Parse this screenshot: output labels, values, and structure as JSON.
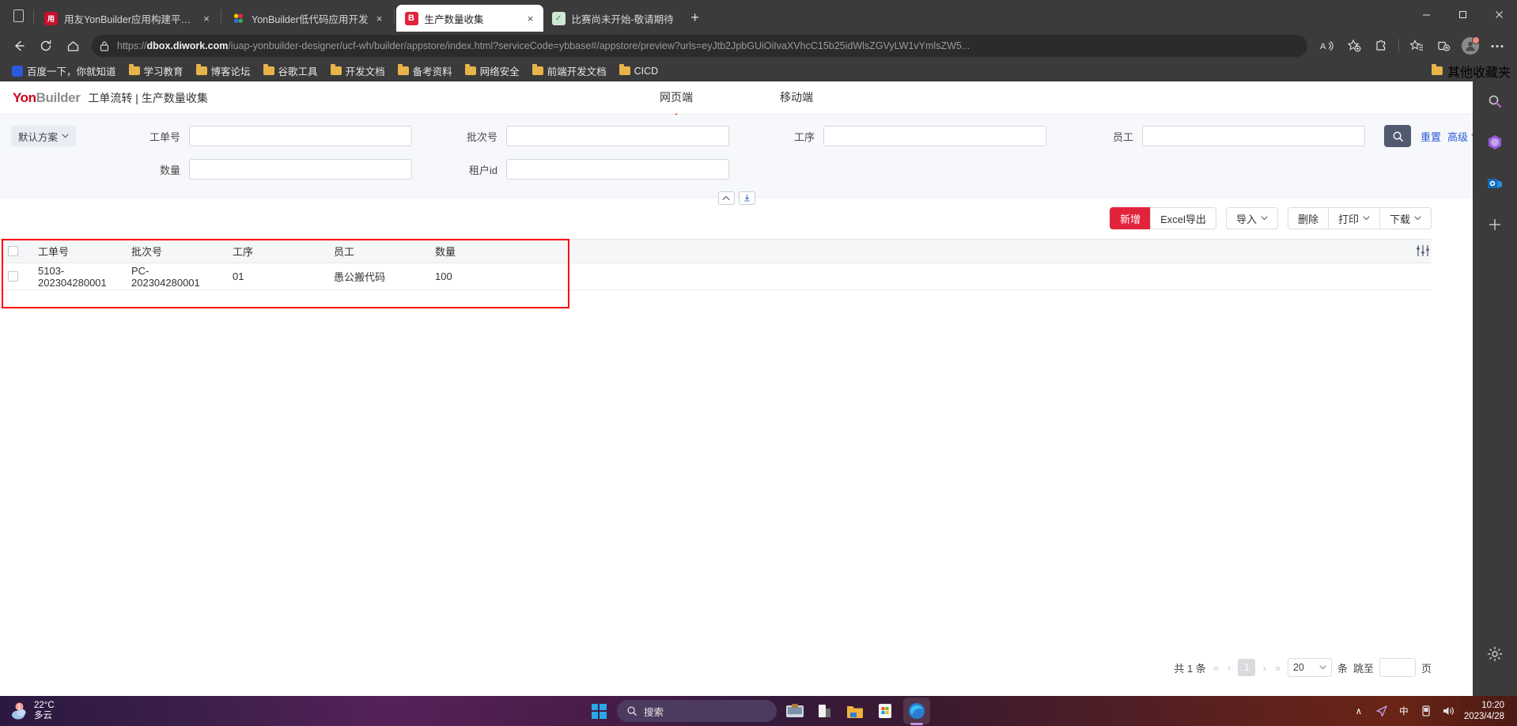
{
  "browser": {
    "tabs": [
      {
        "title": "用友YonBuilder应用构建平台-可",
        "favicon_text": "用",
        "favicon_color": "#c8102e",
        "active": false,
        "close_label": "×"
      },
      {
        "title": "YonBuilder低代码应用开发",
        "favicon_text": "❖",
        "favicon_color": "#f2f2f2",
        "active": false,
        "close_label": "×"
      },
      {
        "title": "生产数量收集",
        "favicon_text": "B",
        "favicon_color": "#e1243b",
        "active": true,
        "close_label": "×"
      },
      {
        "title": "比赛尚未开始-敬请期待",
        "favicon_text": "✓",
        "favicon_color": "#2d8a4e",
        "active": false,
        "close_label": "×"
      }
    ],
    "new_tab_label": "+",
    "window_controls": {
      "minimize": "—",
      "maximize": "☐",
      "close": "×"
    },
    "nav": {
      "back_icon": "back-arrow",
      "reload_icon": "reload",
      "home_icon": "home",
      "url_prefix": "https://",
      "url_domain": "dbox.diwork.com",
      "url_path": "/iuap-yonbuilder-designer/ucf-wh/builder/appstore/index.html?serviceCode=ybbase#/appstore/preview?urls=eyJtb2JpbGUiOiIvaXVhcC15b25idWlsZGVyLW1vYmlsZW5..."
    },
    "bookmarks": [
      {
        "label": "百度一下，你就知道",
        "icon": "baidu-icon"
      },
      {
        "label": "学习教育",
        "icon": "folder-icon"
      },
      {
        "label": "博客论坛",
        "icon": "folder-icon"
      },
      {
        "label": "谷歌工具",
        "icon": "folder-icon"
      },
      {
        "label": "开发文档",
        "icon": "folder-icon"
      },
      {
        "label": "备考资料",
        "icon": "folder-icon"
      },
      {
        "label": "网络安全",
        "icon": "folder-icon"
      },
      {
        "label": "前端开发文档",
        "icon": "folder-icon"
      },
      {
        "label": "CICD",
        "icon": "folder-icon"
      }
    ],
    "other_bookmarks": "其他收藏夹"
  },
  "app": {
    "logo_yon": "Yon",
    "logo_builder": "Builder",
    "breadcrumb": "工单流转 | 生产数量收集",
    "segments": [
      {
        "label": "网页端",
        "active": true
      },
      {
        "label": "移动端",
        "active": false
      }
    ]
  },
  "search": {
    "scheme_label": "默认方案",
    "fields": [
      {
        "label": "工单号",
        "value": "",
        "placeholder": ""
      },
      {
        "label": "批次号",
        "value": "",
        "placeholder": ""
      },
      {
        "label": "工序",
        "value": "",
        "placeholder": ""
      },
      {
        "label": "员工",
        "value": "",
        "placeholder": ""
      },
      {
        "label": "数量",
        "value": "",
        "placeholder": ""
      },
      {
        "label": "租户id",
        "value": "",
        "placeholder": ""
      }
    ],
    "search_button_icon": "search-icon",
    "reset_label": "重置",
    "advanced_label": "高级",
    "collapse_icon": "chevron-up-icon",
    "pin_icon": "pin-icon"
  },
  "toolbar": {
    "add_label": "新增",
    "excel_export_label": "Excel导出",
    "import_label": "导入",
    "delete_label": "删除",
    "print_label": "打印",
    "download_label": "下载",
    "columns_icon": "column-settings-icon"
  },
  "table": {
    "columns": [
      "工单号",
      "批次号",
      "工序",
      "员工",
      "数量",
      ""
    ],
    "rows": [
      {
        "cells": [
          "5103-202304280001",
          "PC-202304280001",
          "01",
          "愚公搬代码",
          "100",
          ""
        ]
      }
    ]
  },
  "pagination": {
    "total_label": "共 1 条",
    "first_icon": "«",
    "prev_icon": "‹",
    "current_page": "1",
    "next_icon": "›",
    "last_icon": "»",
    "page_size": "20",
    "unit_label": "条",
    "jump_label": "跳至",
    "jump_value": "",
    "page_label": "页"
  },
  "taskbar": {
    "weather_temp": "22°C",
    "weather_desc": "多云",
    "weather_badge": "1",
    "start_icon": "windows-start-icon",
    "search_placeholder": "搜索",
    "apps": [
      {
        "name": "file-explorer-icon"
      },
      {
        "name": "camera-icon"
      },
      {
        "name": "notes-icon"
      },
      {
        "name": "folder-icon"
      },
      {
        "name": "store-icon"
      },
      {
        "name": "edge-icon"
      }
    ],
    "tray": {
      "overflow": "∧",
      "network_icon": "network-icon",
      "ime_label": "中",
      "battery_icon": "battery-icon",
      "volume_icon": "volume-icon",
      "time": "10:20",
      "date": "2023/4/28"
    }
  },
  "colors": {
    "accent_red": "#e1243b",
    "link_blue": "#2a5bd7",
    "panel_bg": "#f7f8fb",
    "chrome_bg": "#3b3b3b"
  }
}
